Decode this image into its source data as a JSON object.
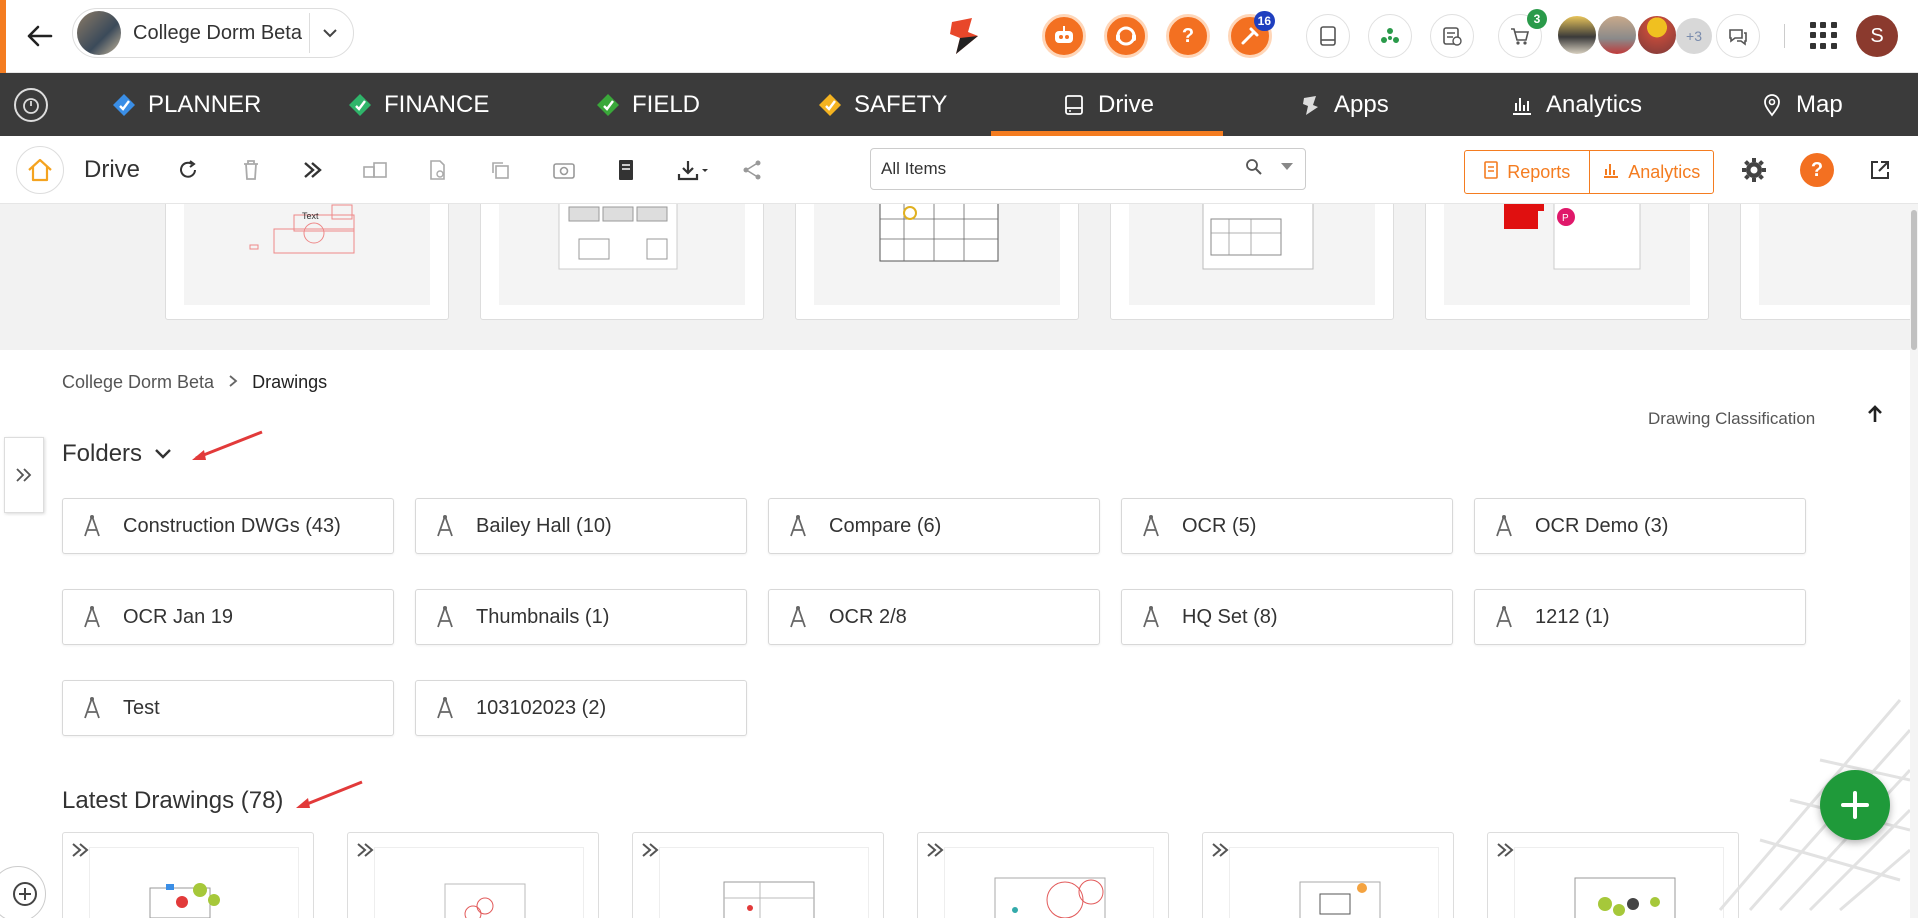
{
  "header": {
    "project_name": "College Dorm Beta",
    "badges": {
      "tasks": "16",
      "notifications": "3",
      "avatars_more": "+3"
    },
    "user_initial": "S"
  },
  "nav": {
    "items": [
      {
        "label": "PLANNER",
        "color": "#3a8ee6"
      },
      {
        "label": "FINANCE",
        "color": "#2fb56a"
      },
      {
        "label": "FIELD",
        "color": "#3aa83a"
      },
      {
        "label": "SAFETY",
        "color": "#f4b320"
      },
      {
        "label": "Drive",
        "color": "#ffffff",
        "active": true
      },
      {
        "label": "Apps",
        "color": "#ffffff"
      },
      {
        "label": "Analytics",
        "color": "#ffffff"
      },
      {
        "label": "Map",
        "color": "#ffffff"
      }
    ]
  },
  "toolbar": {
    "title": "Drive",
    "search_value": "All Items",
    "reports_label": "Reports",
    "analytics_label": "Analytics"
  },
  "strip": {
    "first_card_text": "Text",
    "badge_letter": "P"
  },
  "breadcrumb": {
    "root": "College Dorm Beta",
    "current": "Drawings"
  },
  "classification_label": "Drawing Classification",
  "folders_title": "Folders",
  "folders": [
    "Construction DWGs (43)",
    "Bailey Hall (10)",
    "Compare (6)",
    "OCR (5)",
    "OCR Demo (3)",
    "OCR Jan 19",
    "Thumbnails (1)",
    "OCR 2/8",
    "HQ Set (8)",
    "1212 (1)",
    "Test",
    "103102023 (2)"
  ],
  "latest_title": "Latest Drawings (78)",
  "colors": {
    "accent": "#f47c20",
    "fab": "#1f9a3a",
    "nav_bg": "#3b3b3b"
  }
}
